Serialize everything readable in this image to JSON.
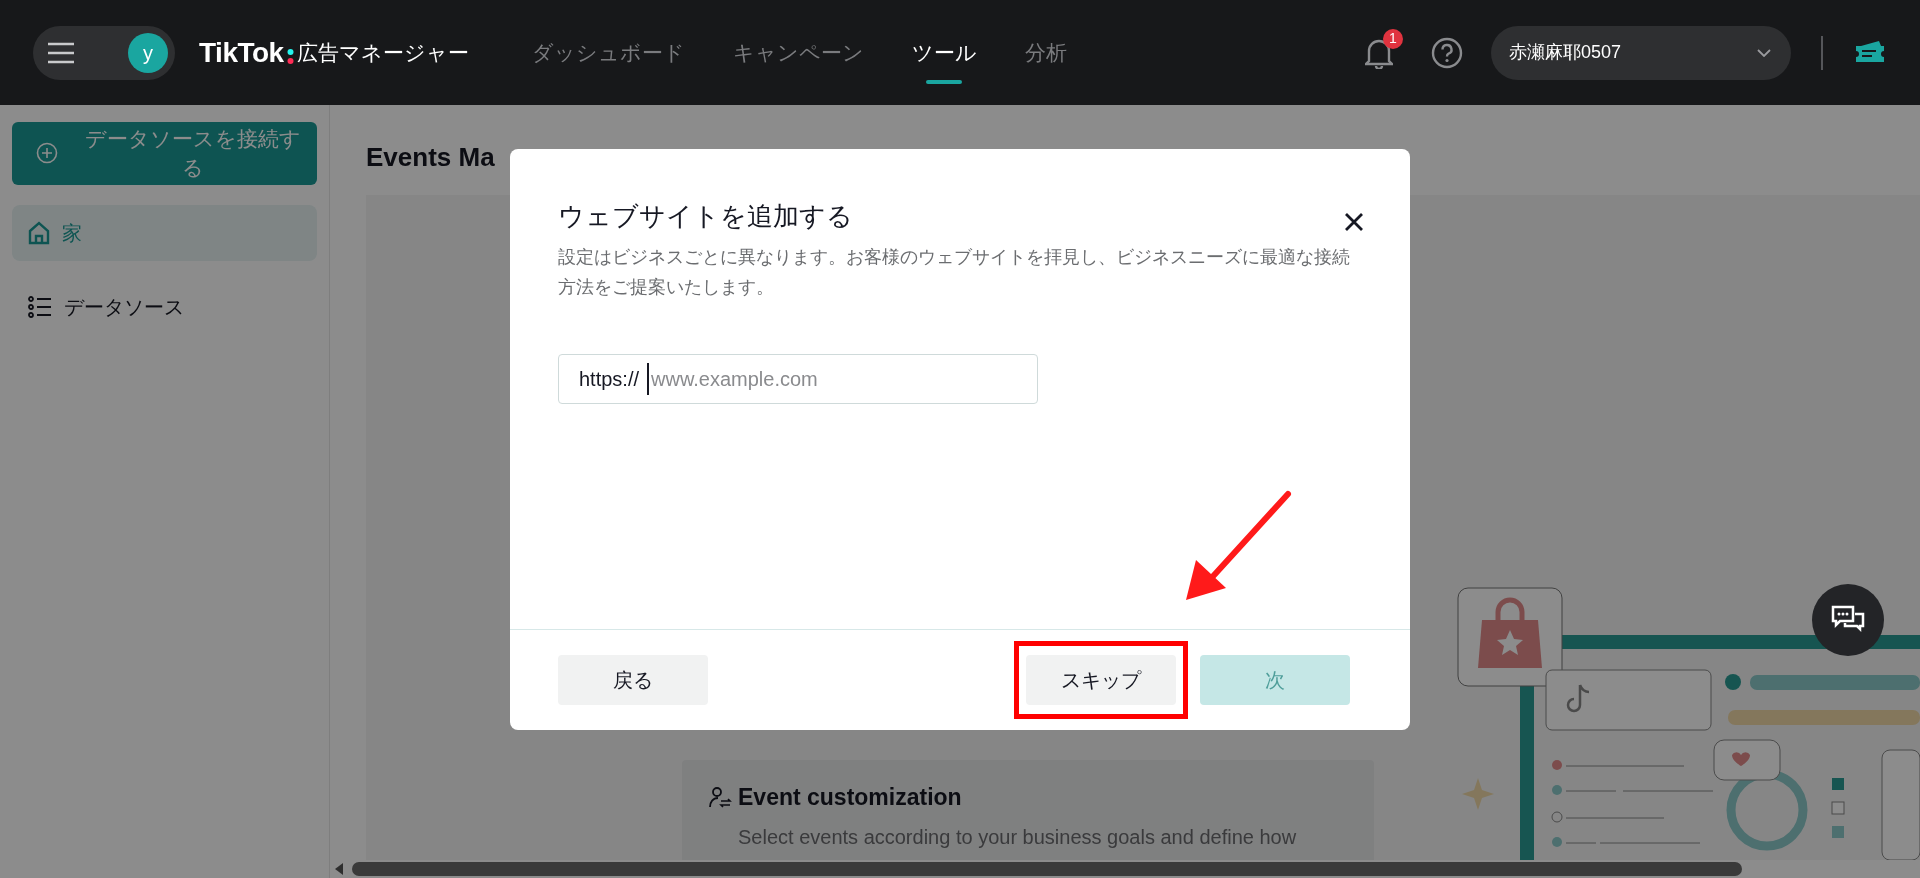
{
  "topbar": {
    "avatar_letter": "y",
    "logo_text": "TikTok",
    "logo_suffix": "広告マネージャー",
    "nav": [
      {
        "label": "ダッシュボード",
        "selected": false
      },
      {
        "label": "キャンペーン",
        "selected": false
      },
      {
        "label": "ツール",
        "selected": true
      },
      {
        "label": "分析",
        "selected": false
      }
    ],
    "notification_count": "1",
    "account": "赤瀬麻耶0507"
  },
  "sidebar": {
    "connect_button": "データソースを接続する",
    "items": [
      {
        "label": "家",
        "selected": true
      },
      {
        "label": "データソース",
        "selected": false
      }
    ]
  },
  "page": {
    "title": "Events Ma",
    "feature_card": {
      "title": "Event customization",
      "description": "Select events according to your business goals and define how"
    }
  },
  "modal": {
    "title": "ウェブサイトを追加する",
    "description": "設定はビジネスごとに異なります。お客様のウェブサイトを拝見し、ビジネスニーズに最適な接続方法をご提案いたします。",
    "url_prefix": "https://",
    "placeholder": "www.example.com",
    "buttons": [
      {
        "label": "戻る",
        "kind": "back",
        "disabled": false,
        "highlighted": false
      },
      {
        "label": "スキップ",
        "kind": "skip",
        "disabled": false,
        "highlighted": true
      },
      {
        "label": "次",
        "kind": "next",
        "disabled": true,
        "highlighted": false
      }
    ]
  }
}
